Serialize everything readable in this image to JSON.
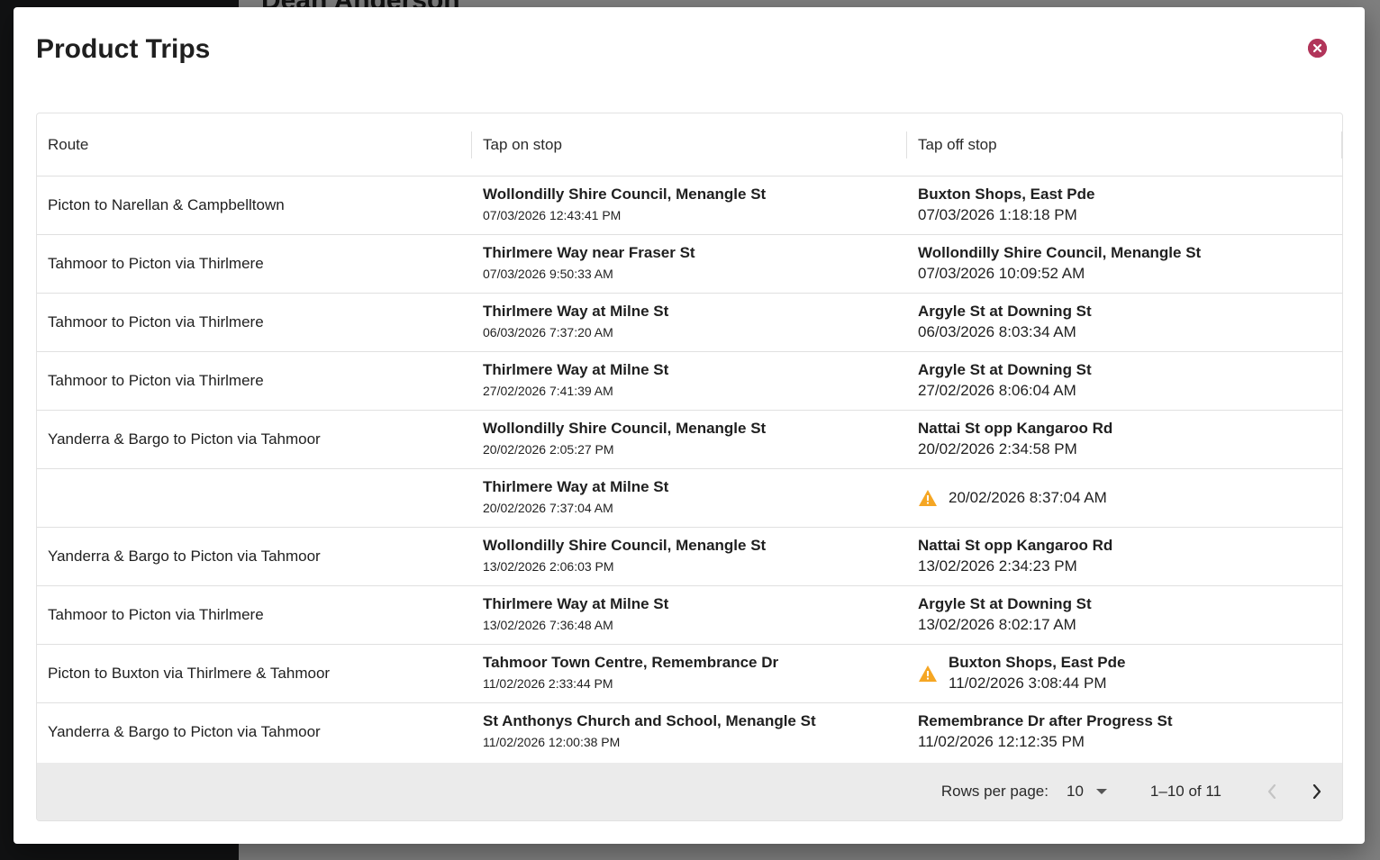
{
  "background": {
    "user_name": "Dean Anderson"
  },
  "modal": {
    "title": "Product Trips",
    "close_icon": "close-circle-icon"
  },
  "table": {
    "headers": [
      "Route",
      "Tap on stop",
      "Tap off stop"
    ],
    "rows": [
      {
        "route": "Picton to Narellan & Campbelltown",
        "tap_on": {
          "stop": "Wollondilly Shire Council, Menangle St",
          "time": "07/03/2026 12:43:41 PM"
        },
        "tap_off": {
          "stop": "Buxton Shops, East Pde",
          "time": "07/03/2026 1:18:18 PM",
          "warning": false
        }
      },
      {
        "route": "Tahmoor to Picton via Thirlmere",
        "tap_on": {
          "stop": "Thirlmere Way near Fraser St",
          "time": "07/03/2026 9:50:33 AM"
        },
        "tap_off": {
          "stop": "Wollondilly Shire Council, Menangle St",
          "time": "07/03/2026 10:09:52 AM",
          "warning": false
        }
      },
      {
        "route": "Tahmoor to Picton via Thirlmere",
        "tap_on": {
          "stop": "Thirlmere Way at Milne St",
          "time": "06/03/2026 7:37:20 AM"
        },
        "tap_off": {
          "stop": "Argyle St at Downing St",
          "time": "06/03/2026 8:03:34 AM",
          "warning": false
        }
      },
      {
        "route": "Tahmoor to Picton via Thirlmere",
        "tap_on": {
          "stop": "Thirlmere Way at Milne St",
          "time": "27/02/2026 7:41:39 AM"
        },
        "tap_off": {
          "stop": "Argyle St at Downing St",
          "time": "27/02/2026 8:06:04 AM",
          "warning": false
        }
      },
      {
        "route": "Yanderra & Bargo to Picton via Tahmoor",
        "tap_on": {
          "stop": "Wollondilly Shire Council, Menangle St",
          "time": "20/02/2026 2:05:27 PM"
        },
        "tap_off": {
          "stop": "Nattai St opp Kangaroo Rd",
          "time": "20/02/2026 2:34:58 PM",
          "warning": false
        }
      },
      {
        "route": "",
        "tap_on": {
          "stop": "Thirlmere Way at Milne St",
          "time": "20/02/2026 7:37:04 AM"
        },
        "tap_off": {
          "stop": "",
          "time": "20/02/2026 8:37:04 AM",
          "warning": true
        }
      },
      {
        "route": "Yanderra & Bargo to Picton via Tahmoor",
        "tap_on": {
          "stop": "Wollondilly Shire Council, Menangle St",
          "time": "13/02/2026 2:06:03 PM"
        },
        "tap_off": {
          "stop": "Nattai St opp Kangaroo Rd",
          "time": "13/02/2026 2:34:23 PM",
          "warning": false
        }
      },
      {
        "route": "Tahmoor to Picton via Thirlmere",
        "tap_on": {
          "stop": "Thirlmere Way at Milne St",
          "time": "13/02/2026 7:36:48 AM"
        },
        "tap_off": {
          "stop": "Argyle St at Downing St",
          "time": "13/02/2026 8:02:17 AM",
          "warning": false
        }
      },
      {
        "route": "Picton to Buxton via Thirlmere & Tahmoor",
        "tap_on": {
          "stop": "Tahmoor Town Centre, Remembrance Dr",
          "time": "11/02/2026 2:33:44 PM"
        },
        "tap_off": {
          "stop": "Buxton Shops, East Pde",
          "time": "11/02/2026 3:08:44 PM",
          "warning": true
        }
      },
      {
        "route": "Yanderra & Bargo to Picton via Tahmoor",
        "tap_on": {
          "stop": "St Anthonys Church and School, Menangle St",
          "time": "11/02/2026 12:00:38 PM"
        },
        "tap_off": {
          "stop": "Remembrance Dr after Progress St",
          "time": "11/02/2026 12:12:35 PM",
          "warning": false
        }
      }
    ]
  },
  "pagination": {
    "rows_per_page_label": "Rows per page:",
    "rows_per_page_value": "10",
    "range_text": "1–10 of 11",
    "prev_icon": "chevron-left-icon",
    "next_icon": "chevron-right-icon",
    "prev_disabled": true
  },
  "colors": {
    "close": "#b1355a",
    "warning": "#f5a623",
    "footer_bg": "#ebebeb"
  }
}
